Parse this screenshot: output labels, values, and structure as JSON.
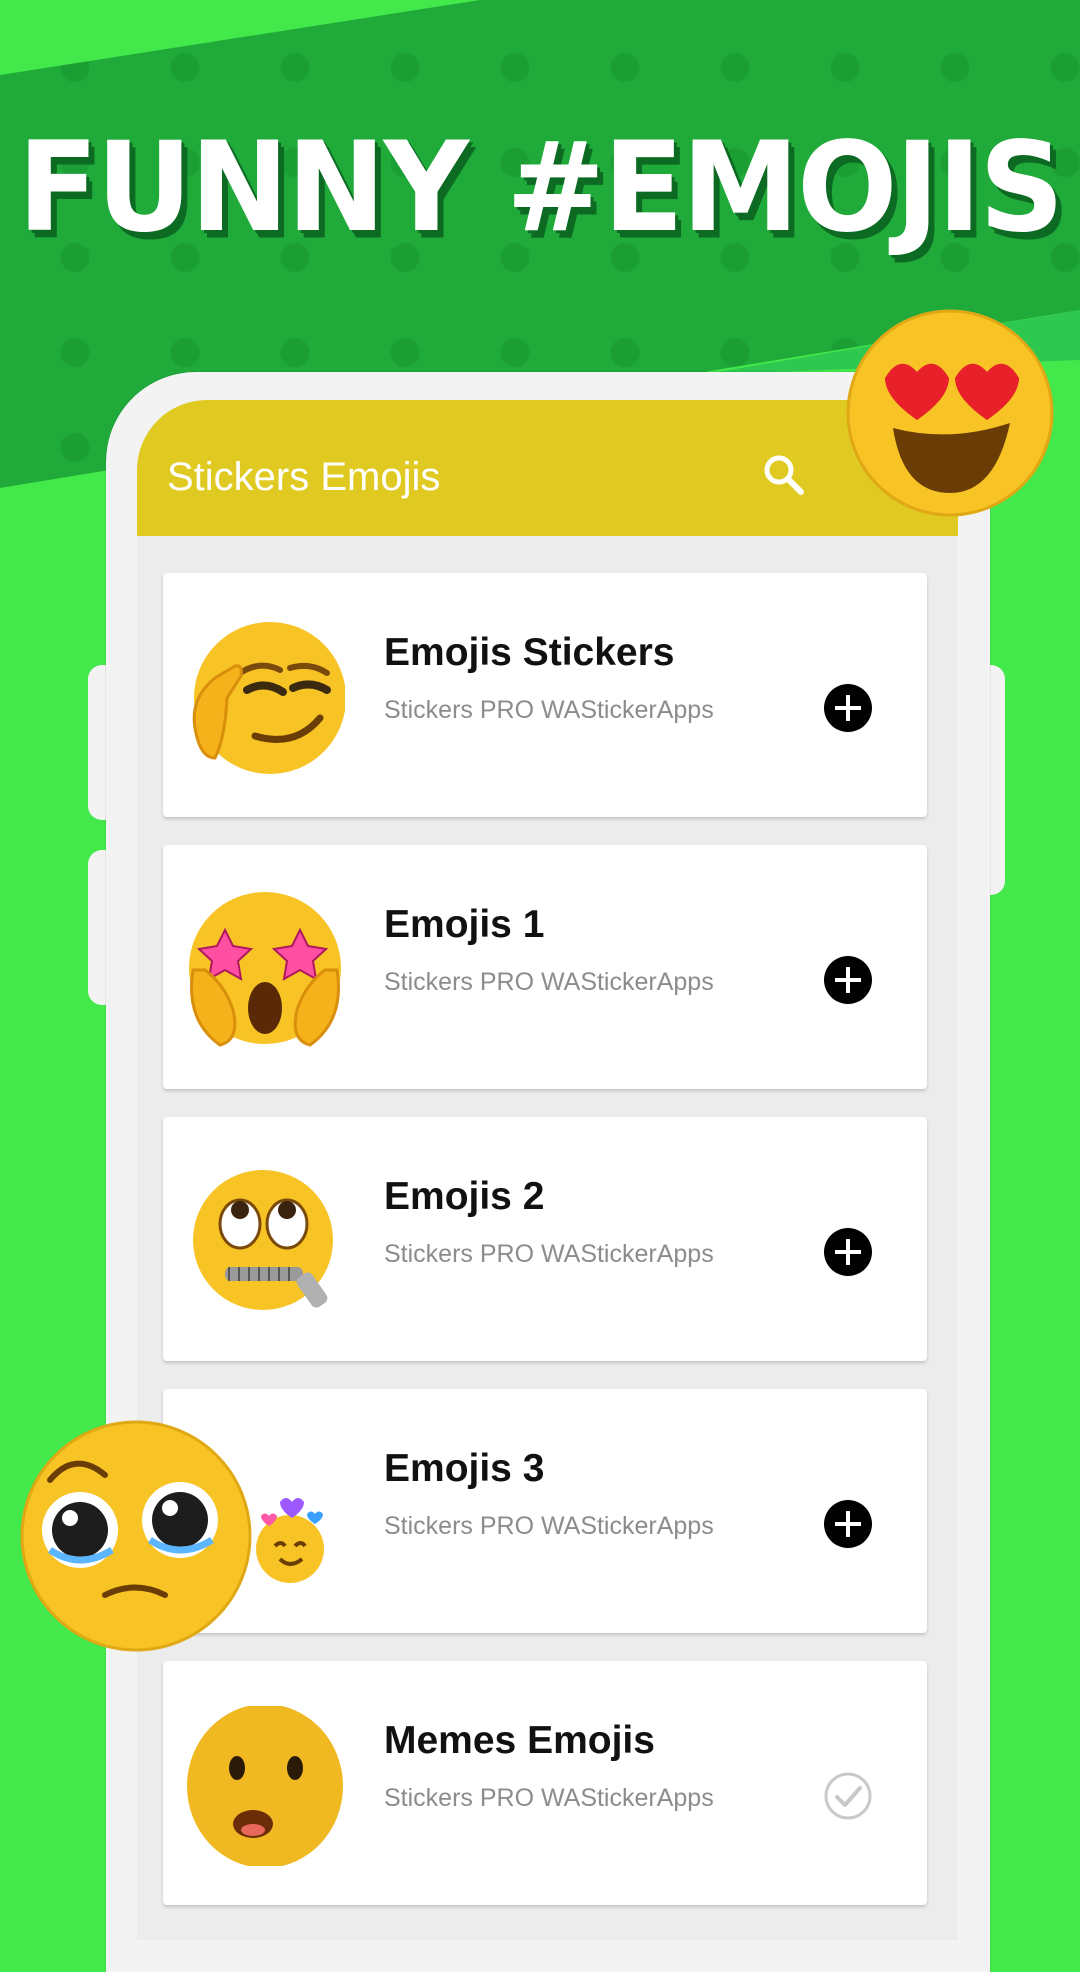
{
  "headline": "FUNNY #EMOJIS",
  "app": {
    "title": "Stickers Emojis",
    "bar_color": "#e0ca22",
    "search_icon": "search-icon"
  },
  "packs": [
    {
      "name": "Emojis Stickers",
      "publisher": "Stickers PRO WAStickerApps",
      "thumb": "saluting-smirk-emoji",
      "status": "add"
    },
    {
      "name": "Emojis 1",
      "publisher": "Stickers PRO WAStickerApps",
      "thumb": "star-struck-scream-emoji",
      "status": "add"
    },
    {
      "name": "Emojis 2",
      "publisher": "Stickers PRO WAStickerApps",
      "thumb": "zipper-mouth-eye-roll-emoji",
      "status": "add"
    },
    {
      "name": "Emojis 3",
      "publisher": "Stickers PRO WAStickerApps",
      "thumb": "smiling-hearts-emoji",
      "status": "add"
    },
    {
      "name": "Memes Emojis",
      "publisher": "Stickers PRO WAStickerApps",
      "thumb": "surprised-meme-emoji",
      "status": "added"
    }
  ],
  "colors": {
    "background": "#43e84a",
    "banner": "#1faa3a",
    "headline_shadow": "#0c6a22"
  }
}
